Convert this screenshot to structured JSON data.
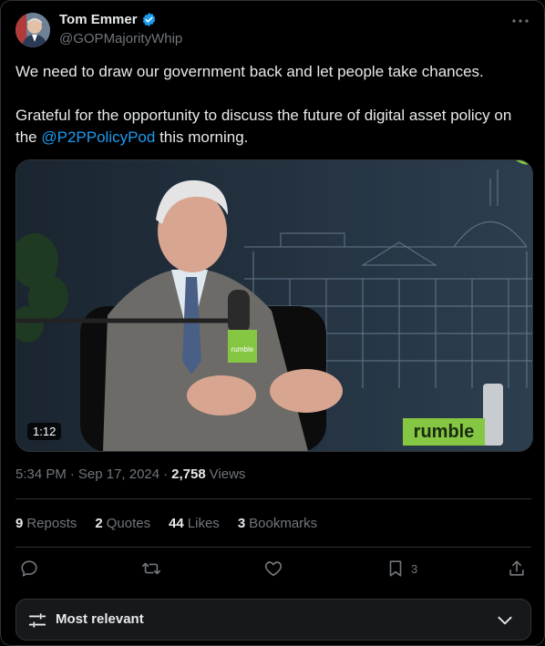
{
  "author": {
    "display_name": "Tom Emmer",
    "handle": "@GOPMajorityWhip"
  },
  "tweet": {
    "line1": "We need to draw our government back and let people take chances.",
    "line2_prefix": "Grateful for the opportunity to discuss the future of digital asset policy on the ",
    "mention": "@P2PPolicyPod",
    "line2_suffix": " this morning."
  },
  "media": {
    "duration": "1:12",
    "mic_flag_text": "rumble",
    "desk_sign_text": "rumble"
  },
  "meta": {
    "time": "5:34 PM",
    "separator": "·",
    "date": "Sep 17, 2024",
    "views_count": "2,758",
    "views_label": "Views"
  },
  "stats": {
    "reposts_count": "9",
    "reposts_label": "Reposts",
    "quotes_count": "2",
    "quotes_label": "Quotes",
    "likes_count": "44",
    "likes_label": "Likes",
    "bookmarks_count": "3",
    "bookmarks_label": "Bookmarks"
  },
  "actions": {
    "bookmark_count": "3"
  },
  "sort": {
    "label": "Most relevant"
  },
  "colors": {
    "accent": "#1d9bf0",
    "rumble_green": "#85c742"
  }
}
